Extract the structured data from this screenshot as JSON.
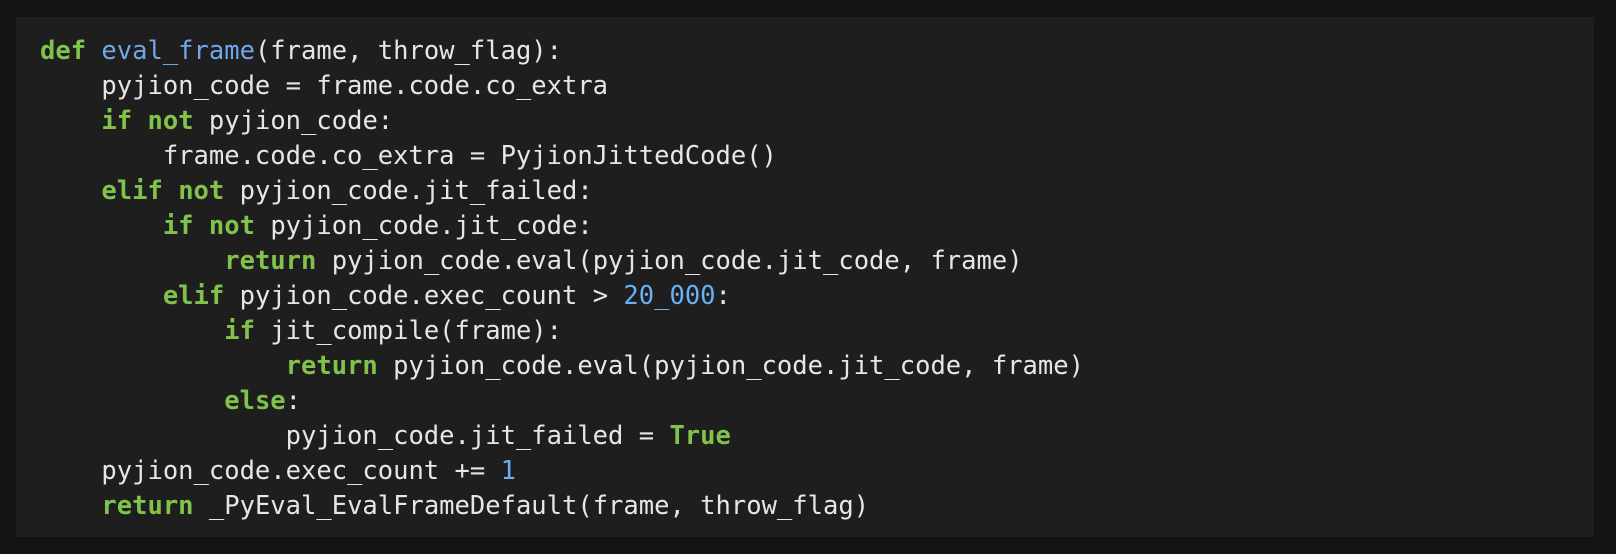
{
  "editor": {
    "language": "python",
    "colors": {
      "background": "#1e1e1e",
      "page": "#141414",
      "text": "#e6e6e6",
      "keyword": "#80c24a",
      "function": "#71a6ea",
      "number": "#6ab0f3"
    },
    "lines": [
      [
        {
          "t": "kw",
          "v": "def"
        },
        {
          "t": "txt",
          "v": " "
        },
        {
          "t": "fn",
          "v": "eval_frame"
        },
        {
          "t": "txt",
          "v": "(frame, throw_flag):"
        }
      ],
      [
        {
          "t": "txt",
          "v": "    pyjion_code = frame.code.co_extra"
        }
      ],
      [
        {
          "t": "txt",
          "v": "    "
        },
        {
          "t": "kw",
          "v": "if"
        },
        {
          "t": "txt",
          "v": " "
        },
        {
          "t": "kw",
          "v": "not"
        },
        {
          "t": "txt",
          "v": " pyjion_code:"
        }
      ],
      [
        {
          "t": "txt",
          "v": "        frame.code.co_extra = PyjionJittedCode()"
        }
      ],
      [
        {
          "t": "txt",
          "v": "    "
        },
        {
          "t": "kw",
          "v": "elif"
        },
        {
          "t": "txt",
          "v": " "
        },
        {
          "t": "kw",
          "v": "not"
        },
        {
          "t": "txt",
          "v": " pyjion_code.jit_failed:"
        }
      ],
      [
        {
          "t": "txt",
          "v": "        "
        },
        {
          "t": "kw",
          "v": "if"
        },
        {
          "t": "txt",
          "v": " "
        },
        {
          "t": "kw",
          "v": "not"
        },
        {
          "t": "txt",
          "v": " pyjion_code.jit_code:"
        }
      ],
      [
        {
          "t": "txt",
          "v": "            "
        },
        {
          "t": "kw",
          "v": "return"
        },
        {
          "t": "txt",
          "v": " pyjion_code.eval(pyjion_code.jit_code, frame)"
        }
      ],
      [
        {
          "t": "txt",
          "v": "        "
        },
        {
          "t": "kw",
          "v": "elif"
        },
        {
          "t": "txt",
          "v": " pyjion_code.exec_count > "
        },
        {
          "t": "num",
          "v": "20_000"
        },
        {
          "t": "txt",
          "v": ":"
        }
      ],
      [
        {
          "t": "txt",
          "v": "            "
        },
        {
          "t": "kw",
          "v": "if"
        },
        {
          "t": "txt",
          "v": " jit_compile(frame):"
        }
      ],
      [
        {
          "t": "txt",
          "v": "                "
        },
        {
          "t": "kw",
          "v": "return"
        },
        {
          "t": "txt",
          "v": " pyjion_code.eval(pyjion_code.jit_code, frame)"
        }
      ],
      [
        {
          "t": "txt",
          "v": "            "
        },
        {
          "t": "kw",
          "v": "else"
        },
        {
          "t": "txt",
          "v": ":"
        }
      ],
      [
        {
          "t": "txt",
          "v": "                pyjion_code.jit_failed = "
        },
        {
          "t": "kw",
          "v": "True"
        }
      ],
      [
        {
          "t": "txt",
          "v": "    pyjion_code.exec_count += "
        },
        {
          "t": "num",
          "v": "1"
        }
      ],
      [
        {
          "t": "txt",
          "v": "    "
        },
        {
          "t": "kw",
          "v": "return"
        },
        {
          "t": "txt",
          "v": " _PyEval_EvalFrameDefault(frame, throw_flag)"
        }
      ]
    ]
  }
}
